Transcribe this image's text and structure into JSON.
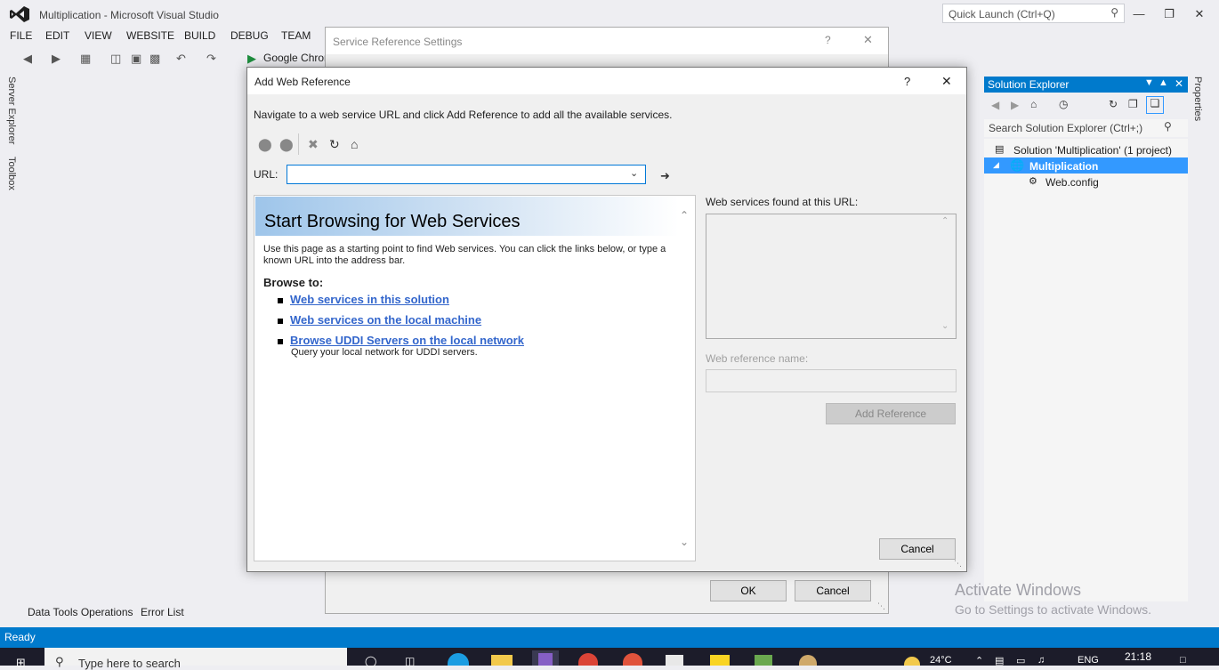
{
  "app": {
    "title": "Multiplication - Microsoft Visual Studio",
    "quick_launch_placeholder": "Quick Launch (Ctrl+Q)"
  },
  "menu": [
    "FILE",
    "EDIT",
    "VIEW",
    "WEBSITE",
    "BUILD",
    "DEBUG",
    "TEAM"
  ],
  "toolbar": {
    "run_target": "Google Chron"
  },
  "side_tabs": {
    "server_explorer": "Server Explorer",
    "toolbox": "Toolbox",
    "properties": "Properties"
  },
  "solution_explorer": {
    "title": "Solution Explorer",
    "search_placeholder": "Search Solution Explorer (Ctrl+;)",
    "tree": [
      {
        "label": "Solution 'Multiplication' (1 project)"
      },
      {
        "label": "Multiplication"
      },
      {
        "label": "Web.config"
      }
    ]
  },
  "service_reference_dialog": {
    "title": "Service Reference Settings",
    "ok_label": "OK",
    "cancel_label": "Cancel",
    "help": "?",
    "close": "✕"
  },
  "add_web_reference": {
    "title": "Add Web Reference",
    "help": "?",
    "close": "✕",
    "instructions": "Navigate to a web service URL and click Add Reference to add all the available services.",
    "url_label": "URL:",
    "url_value": "",
    "browser": {
      "banner_title": "Start Browsing for Web Services",
      "intro": "Use this page as a starting point to find Web services. You can click the links below, or type a known URL into the address bar.",
      "browse_to": "Browse to:",
      "links": [
        "Web services in this solution",
        "Web services on the local machine",
        "Browse UDDI Servers on the local network"
      ],
      "uddi_desc": "Query your local network for UDDI servers."
    },
    "found_label": "Web services found at this URL:",
    "ref_name_label": "Web reference name:",
    "add_reference_label": "Add Reference",
    "cancel_label": "Cancel"
  },
  "bottom_tabs": [
    "Data Tools Operations",
    "Error List"
  ],
  "watermark": {
    "line1": "Activate Windows",
    "line2": "Go to Settings to activate Windows."
  },
  "status": {
    "text": "Ready"
  },
  "taskbar": {
    "search_placeholder": "Type here to search",
    "weather": "24°C",
    "lang": "ENG",
    "time": "21:18"
  }
}
